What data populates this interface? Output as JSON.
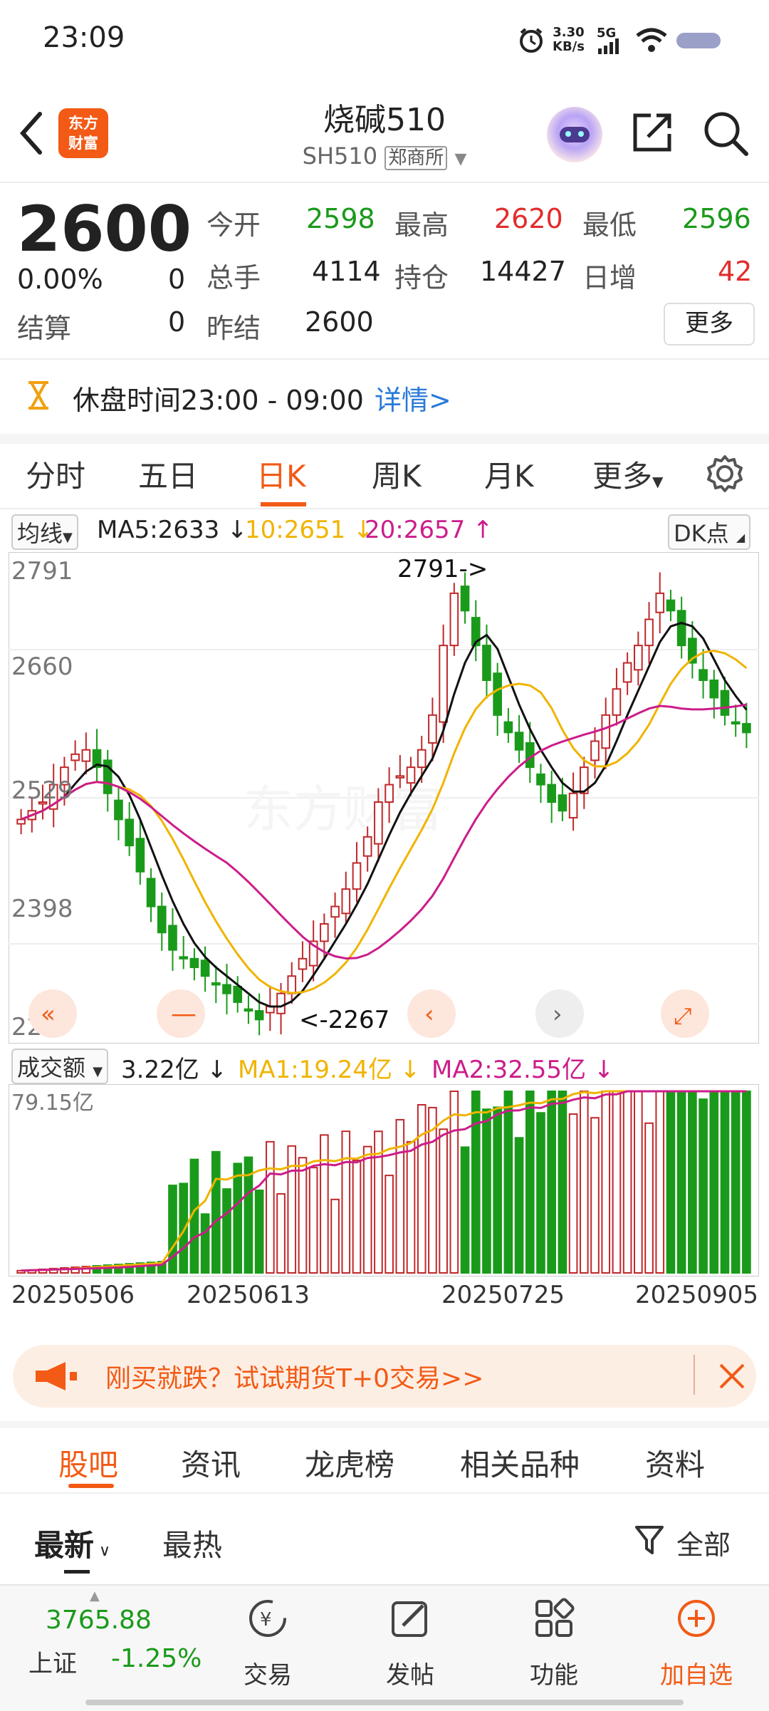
{
  "status_bar": {
    "time": "23:09",
    "speed_value": "3.30",
    "speed_unit": "KB/s",
    "network": "5G"
  },
  "header": {
    "title": "烧碱510",
    "code": "SH510",
    "exchange": "郑商所",
    "logo_line1": "东方",
    "logo_line2": "财富"
  },
  "quote": {
    "price": "2600",
    "change_pct": "0.00%",
    "change_abs": "0",
    "settle_label": "结算",
    "settle_value": "0",
    "open_label": "今开",
    "open_value": "2598",
    "high_label": "最高",
    "high_value": "2620",
    "low_label": "最低",
    "low_value": "2596",
    "volume_label": "总手",
    "volume_value": "4114",
    "oi_label": "持仓",
    "oi_value": "14427",
    "daily_inc_label": "日增",
    "daily_inc_value": "42",
    "prev_settle_label": "昨结",
    "prev_settle_value": "2600",
    "more_label": "更多"
  },
  "session": {
    "text": "休盘时间23:00 - 09:00",
    "link": "详情>"
  },
  "chart_tabs": [
    "分时",
    "五日",
    "日K",
    "周K",
    "月K",
    "更多"
  ],
  "active_chart_tab": "日K",
  "ma_bar": {
    "selector": "均线",
    "ma5": "MA5:2633 ↓",
    "ma10": "10:2651 ↓",
    "ma20": "20:2657 ↑",
    "dk": "DK点"
  },
  "vol_bar": {
    "selector": "成交额",
    "current": "3.22亿 ↓",
    "ma1": "MA1:19.24亿 ↓",
    "ma2": "MA2:32.55亿 ↓"
  },
  "chart_data": [
    {
      "type": "candlestick",
      "y_ticks": [
        "2791",
        "2660",
        "2529",
        "2398",
        "2267"
      ],
      "ylim": [
        2267,
        2791
      ],
      "max_label": "2791->",
      "min_label": "<-2267",
      "x_ticks": [
        "20250506",
        "20250613",
        "20250725",
        "20250905"
      ],
      "series": [
        {
          "name": "MA5",
          "color": "#111111"
        },
        {
          "name": "MA10",
          "color": "#f0b400"
        },
        {
          "name": "MA20",
          "color": "#cc1d8a"
        }
      ],
      "close_approx": [
        2500,
        2510,
        2520,
        2540,
        2560,
        2575,
        2580,
        2560,
        2530,
        2500,
        2470,
        2440,
        2400,
        2370,
        2350,
        2340,
        2330,
        2320,
        2310,
        2300,
        2290,
        2280,
        2270,
        2285,
        2300,
        2320,
        2340,
        2360,
        2380,
        2400,
        2420,
        2450,
        2480,
        2520,
        2540,
        2550,
        2560,
        2580,
        2620,
        2700,
        2760,
        2740,
        2700,
        2660,
        2620,
        2600,
        2580,
        2560,
        2540,
        2520,
        2510,
        2530,
        2560,
        2590,
        2620,
        2650,
        2680,
        2700,
        2730,
        2760,
        2740,
        2700,
        2680,
        2660,
        2640,
        2620,
        2610,
        2600
      ]
    },
    {
      "type": "bar",
      "y_ticks": [
        "79.15亿"
      ],
      "ylim": [
        0,
        79.15
      ]
    }
  ],
  "promo": {
    "text": "刚买就跌？试试期货T+0交易>>"
  },
  "bottom_tabs": [
    "股吧",
    "资讯",
    "龙虎榜",
    "相关品种",
    "资料"
  ],
  "sort": {
    "latest": "最新",
    "hot": "最热",
    "filter": "全部"
  },
  "bottom_nav": {
    "index_value": "3765.88",
    "index_name": "上证",
    "index_change": "-1.25%",
    "trade": "交易",
    "post": "发帖",
    "func": "功能",
    "add": "加自选"
  }
}
